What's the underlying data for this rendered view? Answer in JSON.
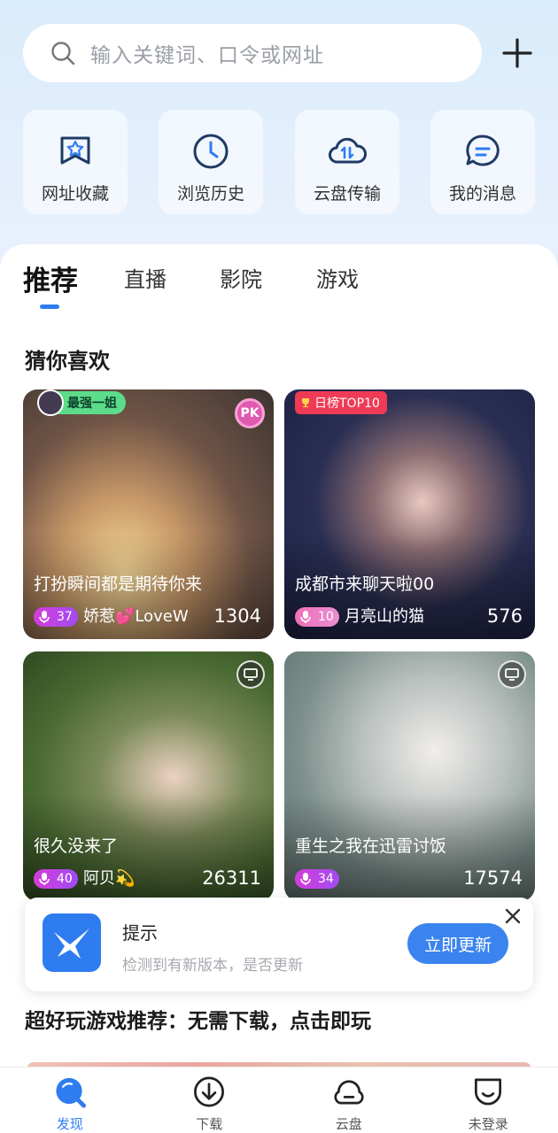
{
  "search": {
    "placeholder": "输入关键词、口令或网址"
  },
  "quick_actions": [
    {
      "label": "网址收藏",
      "icon": "bookmark-star-icon"
    },
    {
      "label": "浏览历史",
      "icon": "clock-icon"
    },
    {
      "label": "云盘传输",
      "icon": "cloud-transfer-icon"
    },
    {
      "label": "我的消息",
      "icon": "message-icon"
    }
  ],
  "tabs": [
    "推荐",
    "直播",
    "影院",
    "游戏"
  ],
  "active_tab": "推荐",
  "section_title": "猜你喜欢",
  "live_cards": [
    {
      "title": "打扮瞬间都是期待你来",
      "level": "37",
      "user": "娇惹💕LoveW",
      "count": "1304",
      "badge": "PK",
      "tag": "最强一姐"
    },
    {
      "title": "成都市来聊天啦00",
      "level": "10",
      "user": "月亮山的猫",
      "count": "576",
      "tag": "日榜TOP10"
    },
    {
      "title": "很久没来了",
      "level": "40",
      "user": "阿贝💫",
      "count": "26311",
      "badge": "tv-icon"
    },
    {
      "title": "重生之我在迅雷讨饭",
      "level": "34",
      "user": "",
      "count": "17574",
      "badge": "tv-icon"
    }
  ],
  "toast": {
    "title": "提示",
    "message": "检测到有新版本，是否更新",
    "button": "立即更新"
  },
  "games_title": "超好玩游戏推荐：无需下载，点击即玩",
  "bottom_nav": [
    {
      "label": "发现",
      "icon": "discover-icon",
      "active": true
    },
    {
      "label": "下载",
      "icon": "download-icon"
    },
    {
      "label": "云盘",
      "icon": "cloud-icon"
    },
    {
      "label": "未登录",
      "icon": "user-face-icon"
    }
  ],
  "colors": {
    "accent": "#2f7cf0",
    "level_badge": "#c84be0",
    "top_tag": "#ef3b56"
  }
}
